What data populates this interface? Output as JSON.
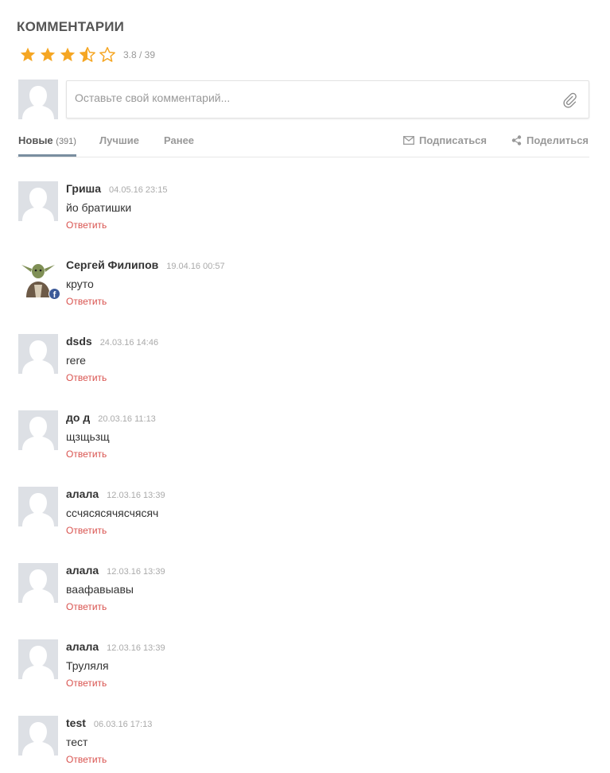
{
  "section": {
    "title": "КОММЕНТАРИИ"
  },
  "rating": {
    "value": 3.8,
    "text": "3.8 / 39",
    "stars": [
      "full",
      "full",
      "full",
      "half",
      "empty"
    ],
    "star_color": "#f5a623"
  },
  "composer": {
    "placeholder": "Оставьте свой комментарий..."
  },
  "tabs": {
    "new_label": "Новые",
    "new_count": "(391)",
    "best_label": "Лучшие",
    "older_label": "Ранее",
    "subscribe_label": "Подписаться",
    "share_label": "Поделиться"
  },
  "colors": {
    "reply_link": "#d9534f",
    "avatar_placeholder": "#dde0e5",
    "facebook": "#3b5998"
  },
  "comments": [
    {
      "author": "Гриша",
      "date": "04.05.16 23:15",
      "text": "йо братишки",
      "reply": "Ответить",
      "avatar": "placeholder"
    },
    {
      "author": "Сергей Филипов",
      "date": "19.04.16 00:57",
      "text": "круто",
      "reply": "Ответить",
      "avatar": "photo",
      "badge": "f"
    },
    {
      "author": "dsds",
      "date": "24.03.16 14:46",
      "text": "rere",
      "reply": "Ответить",
      "avatar": "placeholder"
    },
    {
      "author": "до д",
      "date": "20.03.16 11:13",
      "text": "щзщьзщ",
      "reply": "Ответить",
      "avatar": "placeholder"
    },
    {
      "author": "алала",
      "date": "12.03.16 13:39",
      "text": "ссчясясячясчясяч",
      "reply": "Ответить",
      "avatar": "placeholder"
    },
    {
      "author": "алала",
      "date": "12.03.16 13:39",
      "text": "ваафавыавы",
      "reply": "Ответить",
      "avatar": "placeholder"
    },
    {
      "author": "алала",
      "date": "12.03.16 13:39",
      "text": "Труляля",
      "reply": "Ответить",
      "avatar": "placeholder"
    },
    {
      "author": "test",
      "date": "06.03.16 17:13",
      "text": "тест",
      "reply": "Ответить",
      "avatar": "placeholder"
    }
  ]
}
